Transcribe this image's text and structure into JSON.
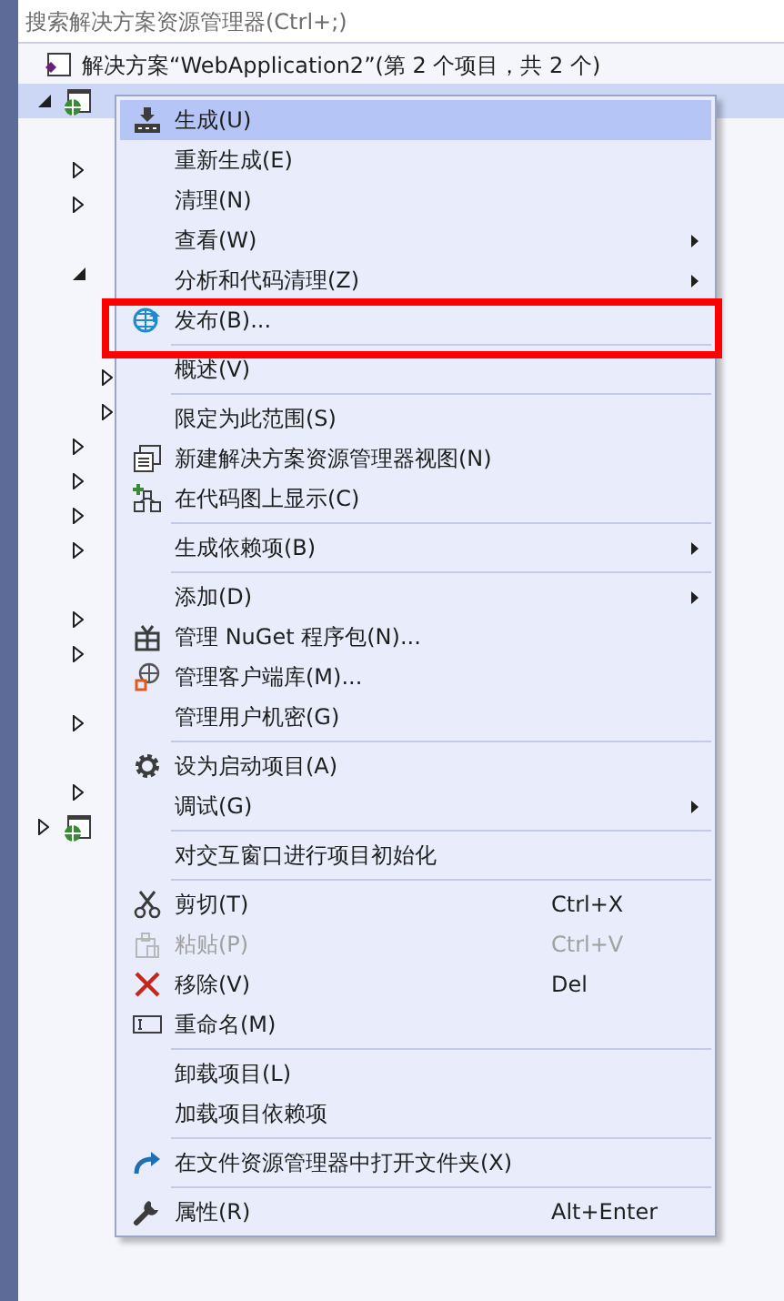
{
  "search": {
    "placeholder": "搜索解决方案资源管理器(Ctrl+;)"
  },
  "solution": {
    "label": "解决方案“WebApplication2”(第 2 个项目，共 2 个)"
  },
  "tree": [
    {
      "kind": "project",
      "selected": true,
      "expanded": true,
      "children": [
        {
          "kind": "leaf"
        },
        {
          "kind": "folder",
          "expanded": false
        },
        {
          "kind": "folder",
          "expanded": false
        },
        {
          "kind": "leaf"
        },
        {
          "kind": "folder",
          "expanded": true,
          "children": [
            {
              "kind": "leaf"
            },
            {
              "kind": "leaf"
            },
            {
              "kind": "folder",
              "expanded": false
            },
            {
              "kind": "folder",
              "expanded": false
            }
          ]
        },
        {
          "kind": "folder",
          "expanded": false
        },
        {
          "kind": "folder",
          "expanded": false
        },
        {
          "kind": "folder",
          "expanded": false
        },
        {
          "kind": "folder",
          "expanded": false
        },
        {
          "kind": "leaf"
        },
        {
          "kind": "folder",
          "expanded": false
        },
        {
          "kind": "folder",
          "expanded": false
        },
        {
          "kind": "leaf"
        },
        {
          "kind": "folder",
          "expanded": false
        },
        {
          "kind": "leaf"
        },
        {
          "kind": "folder",
          "expanded": false
        }
      ]
    },
    {
      "kind": "project",
      "selected": false,
      "expanded": false
    }
  ],
  "context_menu": {
    "groups": [
      [
        {
          "label": "生成(U)",
          "kind": "build",
          "selected": true
        },
        {
          "label": "重新生成(E)",
          "selected": false
        },
        {
          "label": "清理(N)",
          "selected": false
        },
        {
          "label": "查看(W)",
          "submenu": true,
          "selected": false
        },
        {
          "label": "分析和代码清理(Z)",
          "submenu": true,
          "selected": false
        },
        {
          "label": "发布(B)...",
          "kind": "publish",
          "selected": false,
          "annotated": true
        }
      ],
      [
        {
          "label": "概述(V)",
          "selected": false
        }
      ],
      [
        {
          "label": "限定为此范围(S)",
          "selected": false
        },
        {
          "label": "新建解决方案资源管理器视图(N)",
          "kind": "new-view",
          "selected": false
        },
        {
          "label": "在代码图上显示(C)",
          "kind": "code-map",
          "selected": false
        }
      ],
      [
        {
          "label": "生成依赖项(B)",
          "submenu": true,
          "selected": false
        }
      ],
      [
        {
          "label": "添加(D)",
          "submenu": true,
          "selected": false
        },
        {
          "label": "管理 NuGet 程序包(N)...",
          "kind": "package",
          "selected": false
        },
        {
          "label": "管理客户端库(M)...",
          "kind": "client-lib",
          "selected": false
        },
        {
          "label": "管理用户机密(G)",
          "selected": false
        }
      ],
      [
        {
          "label": "设为启动项目(A)",
          "kind": "gear",
          "selected": false
        },
        {
          "label": "调试(G)",
          "submenu": true,
          "selected": false
        }
      ],
      [
        {
          "label": "对交互窗口进行项目初始化",
          "selected": false
        }
      ],
      [
        {
          "label": "剪切(T)",
          "kind": "cut",
          "shortcut": "Ctrl+X",
          "selected": false
        },
        {
          "label": "粘贴(P)",
          "kind": "paste",
          "shortcut": "Ctrl+V",
          "disabled": true,
          "selected": false
        },
        {
          "label": "移除(V)",
          "kind": "remove",
          "shortcut": "Del",
          "selected": false
        },
        {
          "label": "重命名(M)",
          "kind": "rename",
          "selected": false
        }
      ],
      [
        {
          "label": "卸载项目(L)",
          "selected": false
        },
        {
          "label": "加载项目依赖项",
          "selected": false
        }
      ],
      [
        {
          "label": "在文件资源管理器中打开文件夹(X)",
          "kind": "open-folder",
          "selected": false
        }
      ],
      [
        {
          "label": "属性(R)",
          "kind": "wrench",
          "shortcut": "Alt+Enter",
          "selected": false
        }
      ]
    ]
  }
}
